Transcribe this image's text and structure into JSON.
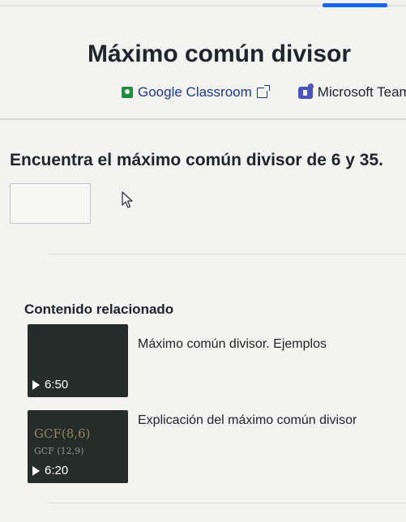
{
  "page": {
    "title": "Máximo común divisor"
  },
  "share": {
    "google_classroom_label": "Google Classroom",
    "microsoft_teams_label": "Microsoft Teams",
    "google_classroom_icon": "google-classroom-icon",
    "external_link_icon": "external-link-icon",
    "microsoft_teams_icon": "microsoft-teams-icon"
  },
  "exercise": {
    "question": "Encuentra el máximo común divisor de 6 y 35.",
    "answer_value": ""
  },
  "related": {
    "heading": "Contenido relacionado",
    "videos": [
      {
        "title": "Máximo común divisor. Ejemplos",
        "duration": "6:50",
        "thumb_text": "",
        "thumb_subtext": ""
      },
      {
        "title": "Explicación del máximo común divisor",
        "duration": "6:20",
        "thumb_text": "GCF(8,6)",
        "thumb_subtext": "GCF (12,9)"
      }
    ]
  },
  "colors": {
    "accent": "#1865f2",
    "link": "#1d3a8a",
    "google_classroom": "#1e8e3e",
    "microsoft_teams": "#4b53bc",
    "thumbnail_bg": "#262c2a"
  }
}
